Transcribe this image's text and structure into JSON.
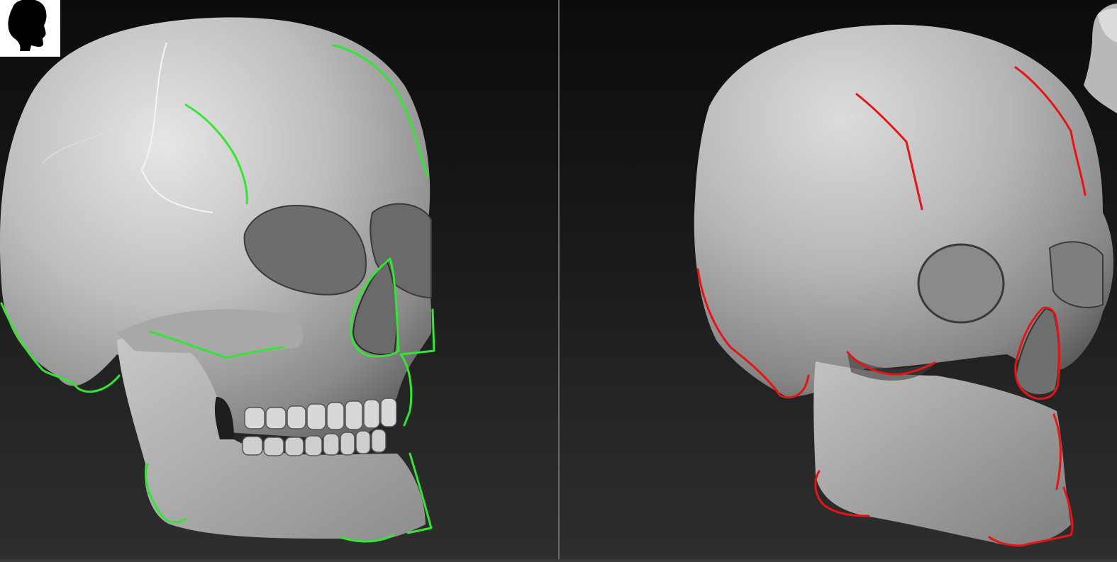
{
  "viewports": {
    "left": {
      "model": "high-resolution-skull-sculpt",
      "outline_color": "#33e633"
    },
    "right": {
      "model": "low-resolution-skull-sculpt",
      "outline_color": "#e61414"
    }
  },
  "icons": {
    "head_silhouette": "head-silhouette-icon",
    "reference_thumbnail": "reference-head-thumbnail-icon"
  }
}
